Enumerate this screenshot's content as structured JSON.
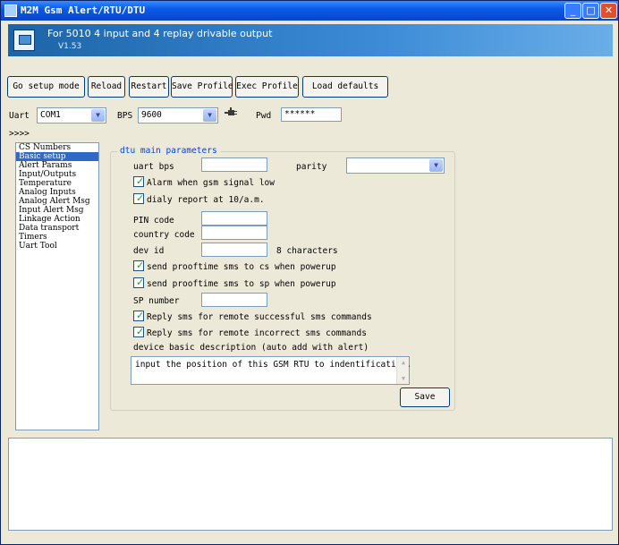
{
  "window": {
    "title": "M2M Gsm Alert/RTU/DTU",
    "controls": {
      "minimize": "_",
      "maximize": "□",
      "close": "✕"
    }
  },
  "banner": {
    "heading": "For 5010 4 input and 4 replay drivable output",
    "version": "V1.53"
  },
  "toolbar": {
    "buttons": [
      {
        "label": "Go setup mode"
      },
      {
        "label": "Reload"
      },
      {
        "label": "Restart"
      },
      {
        "label": "Save Profile"
      },
      {
        "label": "Exec Profile"
      },
      {
        "label": "Load defaults"
      }
    ]
  },
  "connection": {
    "uart_label": "Uart",
    "uart_value": "COM1",
    "bps_label": "BPS",
    "bps_value": "9600",
    "pwd_label": "Pwd",
    "pwd_value": "******",
    "more": ">>>>"
  },
  "nav": {
    "items": [
      {
        "label": "CS Numbers",
        "selected": false
      },
      {
        "label": "Basic setup",
        "selected": true
      },
      {
        "label": "Alert Params",
        "selected": false
      },
      {
        "label": "Input/Outputs",
        "selected": false
      },
      {
        "label": "Temperature",
        "selected": false
      },
      {
        "label": "Analog Inputs",
        "selected": false
      },
      {
        "label": "Analog Alert Msg",
        "selected": false
      },
      {
        "label": "Input Alert Msg",
        "selected": false
      },
      {
        "label": "Linkage Action",
        "selected": false
      },
      {
        "label": "Data transport",
        "selected": false
      },
      {
        "label": "Timers",
        "selected": false
      },
      {
        "label": "Uart Tool",
        "selected": false
      }
    ]
  },
  "params": {
    "group_title": "dtu main parameters",
    "uart_bps_label": "uart bps",
    "uart_bps_value": "",
    "parity_label": "parity",
    "parity_value": "",
    "alarm_gsm_low": {
      "label": "Alarm when gsm signal low",
      "checked": true
    },
    "daily_report": {
      "label": "dialy report at 10/a.m.",
      "checked": true
    },
    "pin_label": "PIN code",
    "pin_value": "",
    "country_label": "country code",
    "country_value": "",
    "devid_label": "dev id",
    "devid_value": "",
    "devid_hint": "8 characters",
    "prooftime_cs": {
      "label": "send prooftime sms to cs when powerup",
      "checked": true
    },
    "prooftime_sp": {
      "label": "send prooftime sms to sp when powerup",
      "checked": true
    },
    "sp_label": "SP number",
    "sp_value": "",
    "reply_success": {
      "label": "Reply sms for remote successful sms commands",
      "checked": true
    },
    "reply_incorrect": {
      "label": "Reply sms for remote incorrect sms commands",
      "checked": true
    },
    "desc_label": "device basic description (auto add with alert)",
    "desc_value": "input the position of this GSM RTU to indentification.",
    "save_label": "Save"
  },
  "log": {
    "content": ""
  },
  "icons": {
    "app": "app-icon",
    "logo": "monitor-icon",
    "connect": "plug-icon",
    "tick": "checkmark-icon"
  }
}
